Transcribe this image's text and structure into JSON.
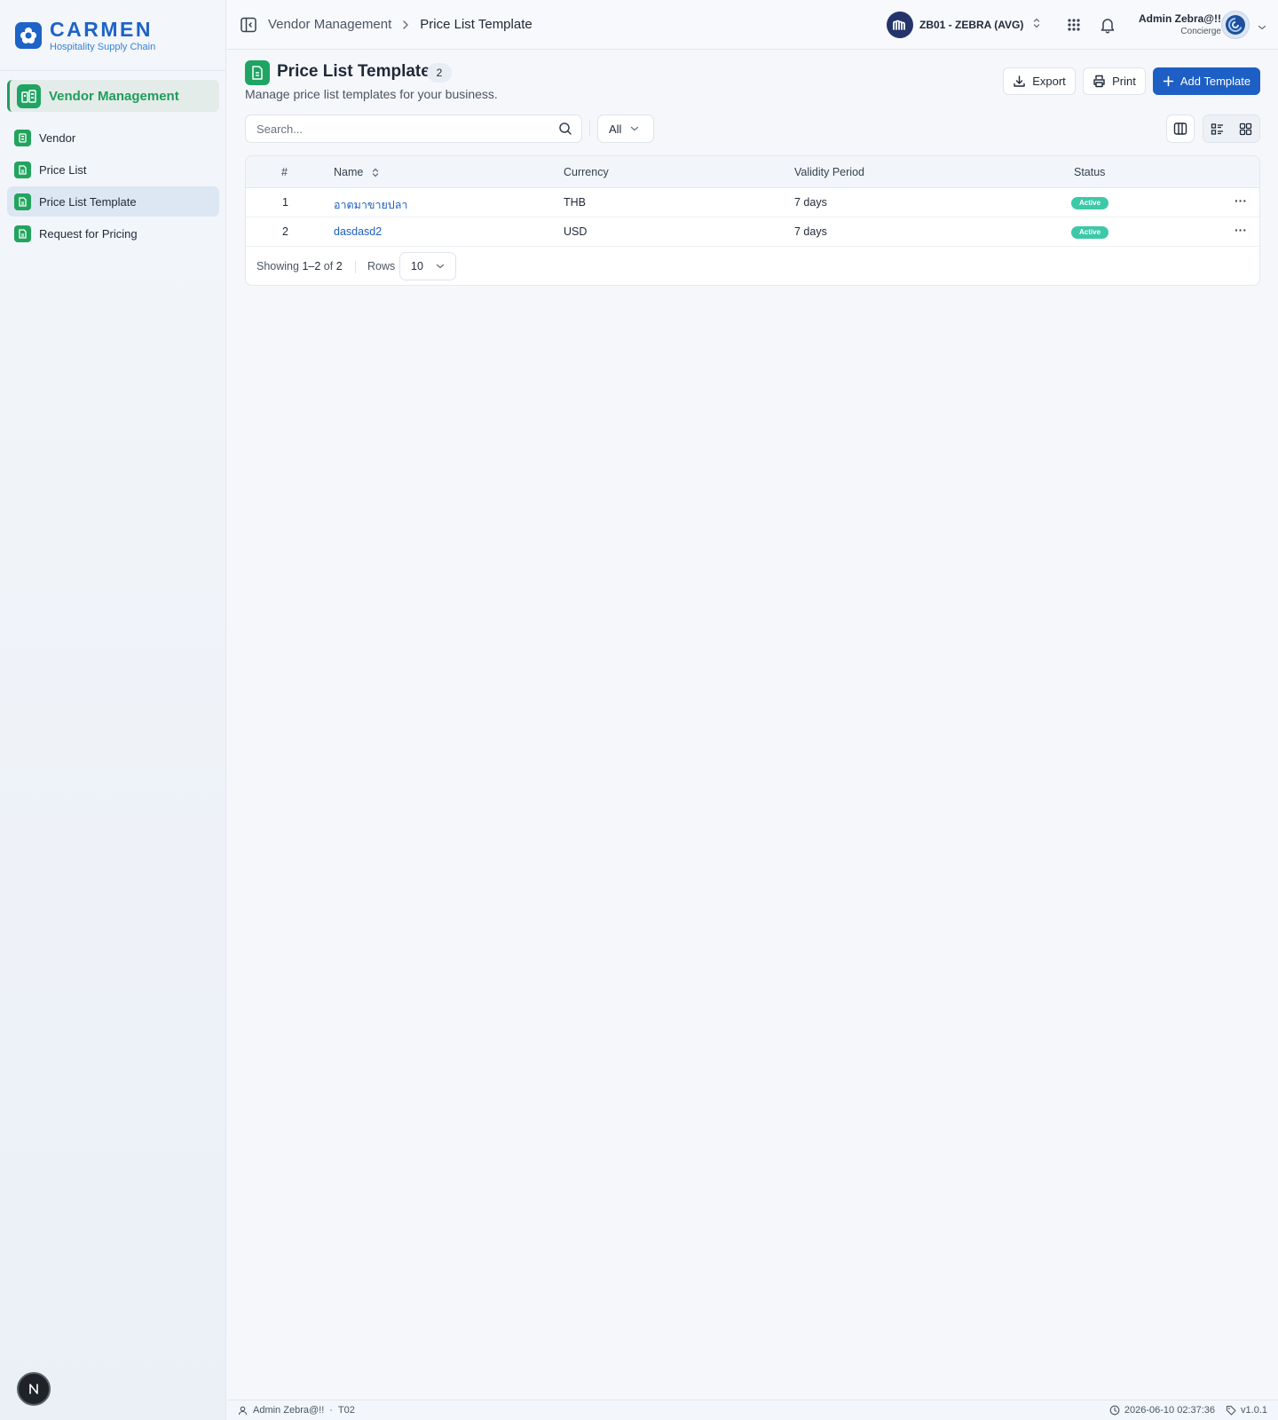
{
  "brand": {
    "name": "CARMEN",
    "subtitle": "Hospitality Supply Chain"
  },
  "sidebar": {
    "module": "Vendor Management",
    "items": [
      {
        "label": "Vendor"
      },
      {
        "label": "Price List"
      },
      {
        "label": "Price List Template",
        "active": true
      },
      {
        "label": "Request for Pricing"
      }
    ],
    "badge": "N"
  },
  "header": {
    "breadcrumb": {
      "parent": "Vendor Management",
      "current": "Price List Template"
    },
    "business_unit": "ZB01 - ZEBRA (AVG)",
    "user": {
      "name": "Admin Zebra@!!",
      "role": "Concierge"
    }
  },
  "page": {
    "title": "Price List Template",
    "count": "2",
    "description": "Manage price list templates for your business.",
    "actions": {
      "export": "Export",
      "print": "Print",
      "add": "Add Template"
    }
  },
  "filters": {
    "search_placeholder": "Search...",
    "status_filter": "All"
  },
  "table": {
    "columns": {
      "index": "#",
      "name": "Name",
      "currency": "Currency",
      "validity": "Validity Period",
      "status": "Status"
    },
    "rows": [
      {
        "index": "1",
        "name": "อาตมาขายปลา",
        "currency": "THB",
        "validity": "7 days",
        "status": "Active"
      },
      {
        "index": "2",
        "name": "dasdasd2",
        "currency": "USD",
        "validity": "7 days",
        "status": "Active"
      }
    ],
    "more_label": "···",
    "footer": {
      "showing_label": "Showing",
      "range": "1–2",
      "of_label": "of",
      "total": "2",
      "rows_label": "Rows",
      "rows_per_page": "10"
    }
  },
  "statusbar": {
    "user": "Admin Zebra@!!",
    "tenant": "T02",
    "datetime": "2026-06-10 02:37:36",
    "version": "v1.0.1"
  },
  "colors": {
    "primary": "#1d5fc4",
    "module_green": "#1fa463",
    "status_active": "#3cc9a8"
  }
}
